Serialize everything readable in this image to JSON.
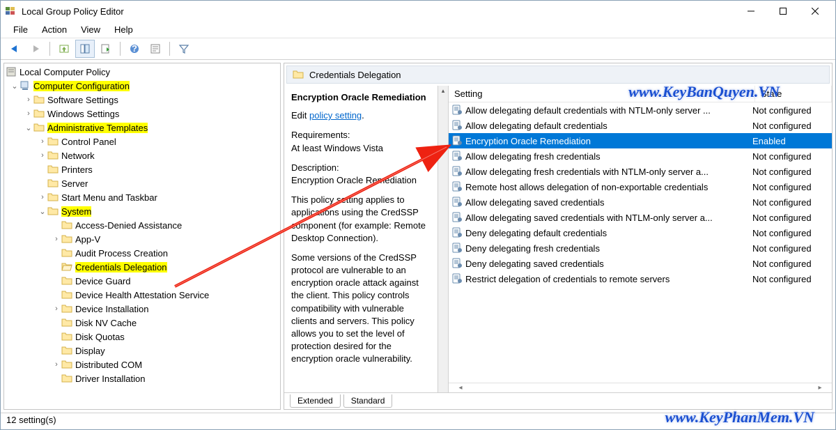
{
  "title": "Local Group Policy Editor",
  "menus": {
    "file": "File",
    "action": "Action",
    "view": "View",
    "help": "Help"
  },
  "tree": {
    "root": "Local Computer Policy",
    "computer_config": "Computer Configuration",
    "software_settings": "Software Settings",
    "windows_settings": "Windows Settings",
    "admin_templates": "Administrative Templates",
    "control_panel": "Control Panel",
    "network": "Network",
    "printers": "Printers",
    "server": "Server",
    "start_menu": "Start Menu and Taskbar",
    "system": "System",
    "system_children": {
      "access_denied": "Access-Denied Assistance",
      "appv": "App-V",
      "audit": "Audit Process Creation",
      "creds": "Credentials Delegation",
      "device_guard": "Device Guard",
      "dhas": "Device Health Attestation Service",
      "device_install": "Device Installation",
      "disk_nv": "Disk NV Cache",
      "disk_quotas": "Disk Quotas",
      "display": "Display",
      "dcom": "Distributed COM",
      "driver_install": "Driver Installation"
    }
  },
  "crumb": "Credentials Delegation",
  "ext": {
    "heading": "Encryption Oracle Remediation",
    "edit_prefix": "Edit ",
    "edit_link": "policy setting",
    "req_label": "Requirements:",
    "req_value": "At least Windows Vista",
    "desc_label": "Description:",
    "desc_value": "Encryption Oracle Remediation",
    "para1": "This policy setting applies to applications using the CredSSP component (for example: Remote Desktop Connection).",
    "para2": "Some versions of the CredSSP protocol are vulnerable to an encryption oracle attack against the client.  This policy controls compatibility with vulnerable clients and servers.  This policy allows you to set the level of protection desired for the encryption oracle vulnerability."
  },
  "columns": {
    "setting": "Setting",
    "state": "State"
  },
  "settings": [
    {
      "name": "Allow delegating default credentials with NTLM-only server ...",
      "state": "Not configured"
    },
    {
      "name": "Allow delegating default credentials",
      "state": "Not configured"
    },
    {
      "name": "Encryption Oracle Remediation",
      "state": "Enabled",
      "selected": true
    },
    {
      "name": "Allow delegating fresh credentials",
      "state": "Not configured"
    },
    {
      "name": "Allow delegating fresh credentials with NTLM-only server a...",
      "state": "Not configured"
    },
    {
      "name": "Remote host allows delegation of non-exportable credentials",
      "state": "Not configured"
    },
    {
      "name": "Allow delegating saved credentials",
      "state": "Not configured"
    },
    {
      "name": "Allow delegating saved credentials with NTLM-only server a...",
      "state": "Not configured"
    },
    {
      "name": "Deny delegating default credentials",
      "state": "Not configured"
    },
    {
      "name": "Deny delegating fresh credentials",
      "state": "Not configured"
    },
    {
      "name": "Deny delegating saved credentials",
      "state": "Not configured"
    },
    {
      "name": "Restrict delegation of credentials to remote servers",
      "state": "Not configured"
    }
  ],
  "tabs": {
    "extended": "Extended",
    "standard": "Standard"
  },
  "status": "12 setting(s)",
  "watermarks": {
    "top": "www.KeyBanQuyen.VN",
    "bottom": "www.KeyPhanMem.VN"
  }
}
